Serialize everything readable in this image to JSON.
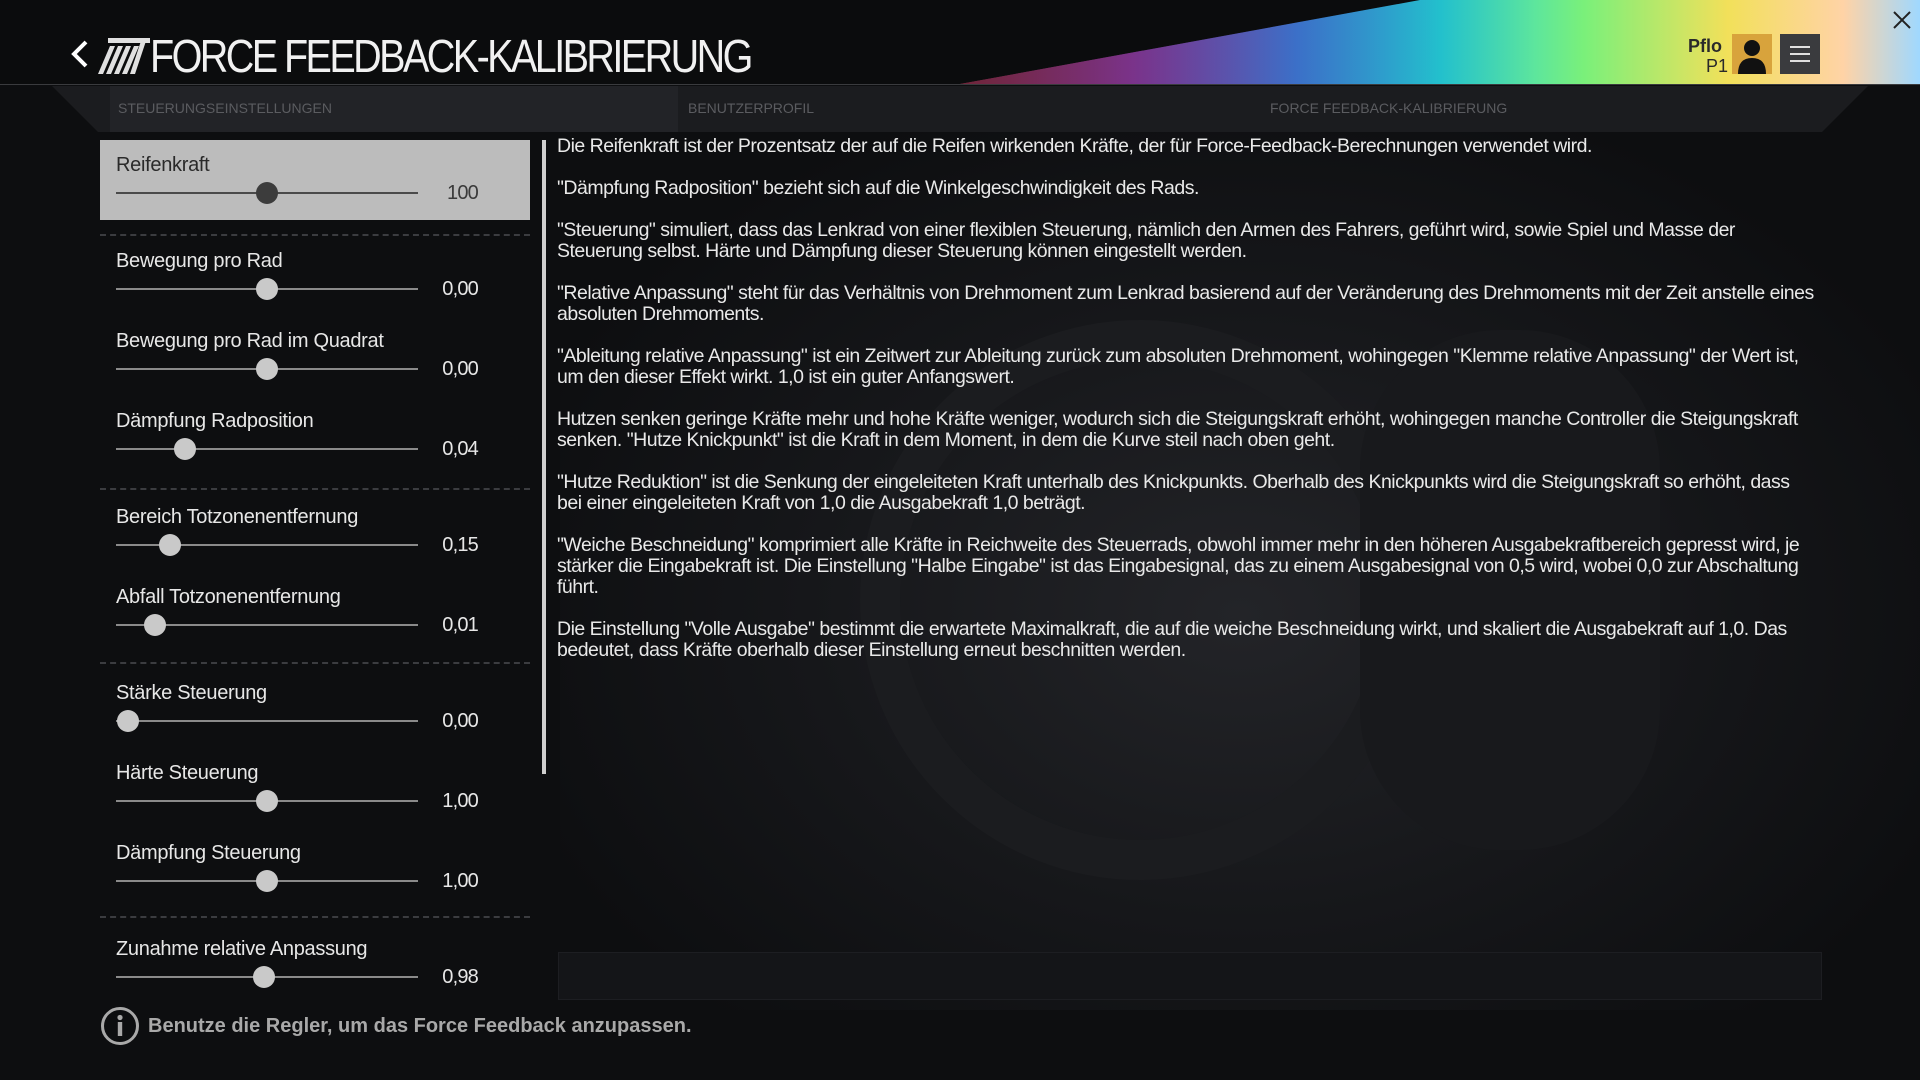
{
  "header": {
    "title": "FORCE FEEDBACK-KALIBRIERUNG",
    "user_name": "Pflo",
    "user_position": "P1",
    "icons": {
      "back": "chevron-left-icon",
      "logo": "stripes-logo",
      "avatar": "user-silhouette-icon",
      "menu": "hamburger-icon",
      "close": "close-icon"
    },
    "avatar_color": "#d8a33c"
  },
  "tabs": [
    {
      "label": "STEUERUNGSEINSTELLUNGEN"
    },
    {
      "label": "BENUTZERPROFIL"
    },
    {
      "label": "FORCE FEEDBACK-KALIBRIERUNG"
    }
  ],
  "sliders": [
    {
      "label": "Reifenkraft",
      "value": "100",
      "fraction": 0.5,
      "selected": true
    },
    {
      "label": "Bewegung pro Rad",
      "value": "0,00",
      "fraction": 0.5
    },
    {
      "label": "Bewegung pro Rad im Quadrat",
      "value": "0,00",
      "fraction": 0.5
    },
    {
      "label": "Dämpfung Radposition",
      "value": "0,04",
      "fraction": 0.23
    },
    {
      "label": "Bereich Totzonenentfernung",
      "value": "0,15",
      "fraction": 0.18
    },
    {
      "label": "Abfall Totzonenentfernung",
      "value": "0,01",
      "fraction": 0.13
    },
    {
      "label": "Stärke Steuerung",
      "value": "0,00",
      "fraction": 0.04
    },
    {
      "label": "Härte Steuerung",
      "value": "1,00",
      "fraction": 0.5
    },
    {
      "label": "Dämpfung Steuerung",
      "value": "1,00",
      "fraction": 0.5
    },
    {
      "label": "Zunahme relative Anpassung",
      "value": "0,98",
      "fraction": 0.49
    }
  ],
  "description": [
    "Die Reifenkraft ist der Prozentsatz der auf die Reifen wirkenden Kräfte, der für Force-Feedback-Berechnungen verwendet wird.",
    "\"Dämpfung Radposition\" bezieht sich auf die Winkelgeschwindigkeit des Rads.",
    "\"Steuerung\" simuliert, dass das Lenkrad von einer flexiblen Steuerung, nämlich den Armen des Fahrers, geführt wird, sowie Spiel und Masse der Steuerung selbst. Härte und Dämpfung dieser Steuerung können eingestellt werden.",
    "\"Relative Anpassung\" steht für das Verhältnis von Drehmoment zum Lenkrad basierend auf der Veränderung des Drehmoments mit der Zeit anstelle eines absoluten Drehmoments.",
    "\"Ableitung relative Anpassung\" ist ein Zeitwert zur Ableitung zurück zum absoluten Drehmoment, wohingegen \"Klemme relative Anpassung\" der Wert ist, um den dieser Effekt wirkt.  1,0 ist ein guter Anfangswert.",
    "Hutzen senken geringe Kräfte mehr und hohe Kräfte weniger, wodurch sich die Steigungskraft erhöht, wohingegen manche Controller die Steigungskraft senken.   \"Hutze Knickpunkt\" ist die Kraft in dem Moment, in dem die Kurve steil nach oben geht.",
    "\"Hutze Reduktion\" ist die Senkung der eingeleiteten Kraft unterhalb des Knickpunkts.  Oberhalb des Knickpunkts wird die Steigungskraft so erhöht, dass bei einer eingeleiteten Kraft von 1,0 die Ausgabekraft 1,0 beträgt.",
    "\"Weiche Beschneidung\" komprimiert alle Kräfte in Reichweite des Steuerrads, obwohl immer mehr in den höheren Ausgabekraftbereich gepresst wird, je stärker die Eingabekraft ist.  Die Einstellung \"Halbe Eingabe\" ist das Eingabesignal, das zu einem Ausgabesignal von 0,5 wird, wobei 0,0 zur Abschaltung führt.",
    "Die Einstellung \"Volle Ausgabe\" bestimmt die erwartete Maximalkraft, die auf die weiche Beschneidung wirkt, und skaliert die Ausgabekraft auf 1,0. Das bedeutet, dass Kräfte oberhalb dieser Einstellung erneut beschnitten werden."
  ],
  "footer": {
    "hint": "Benutze die Regler, um das Force Feedback anzupassen.",
    "icon": "info-icon"
  }
}
